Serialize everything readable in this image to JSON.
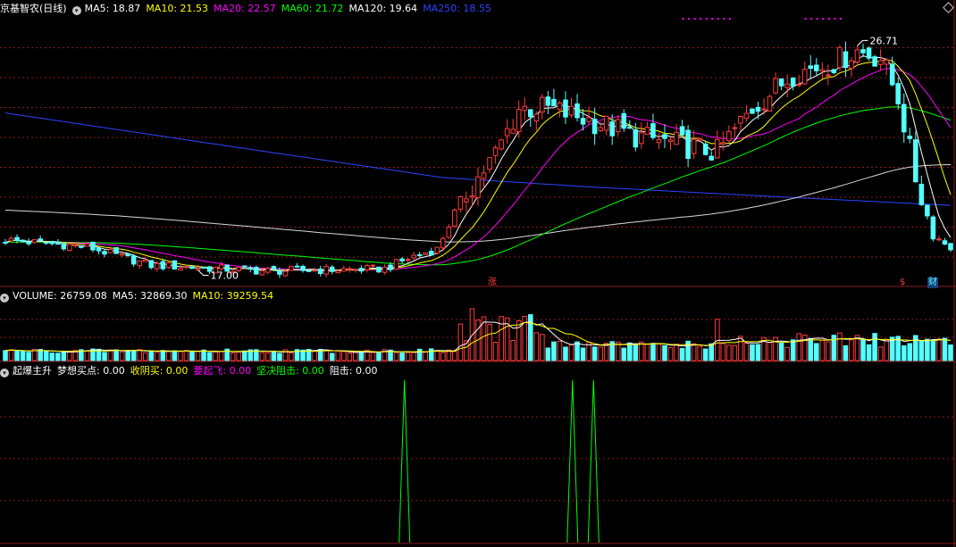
{
  "app": {
    "title": "京基智农(日线)"
  },
  "main_header": [
    {
      "label": "MA5: 18.87",
      "color": "#ffffff"
    },
    {
      "label": "MA10: 21.53",
      "color": "#ffff00"
    },
    {
      "label": "MA20: 22.57",
      "color": "#ff00ff"
    },
    {
      "label": "MA60: 21.72",
      "color": "#00ff00"
    },
    {
      "label": "MA120: 19.64",
      "color": "#ffffff"
    },
    {
      "label": "MA250: 18.55",
      "color": "#2b44ff"
    }
  ],
  "volume_header": [
    {
      "label": "VOLUME: 26759.08",
      "color": "#ffffff"
    },
    {
      "label": "MA5: 32869.30",
      "color": "#ffffff"
    },
    {
      "label": "MA10: 39259.54",
      "color": "#ffff00"
    }
  ],
  "indicator_header": {
    "name": "起爆主升",
    "items": [
      {
        "label": "梦想买点: 0.00",
        "color": "#ffffff"
      },
      {
        "label": "收阴买: 0.00",
        "color": "#ffff00"
      },
      {
        "label": "要起飞: 0.00",
        "color": "#ff00ff"
      },
      {
        "label": "坚决阻击: 0.00",
        "color": "#00ff00"
      },
      {
        "label": "阻击: 0.00",
        "color": "#ffffff"
      }
    ]
  },
  "markers": {
    "zhang": "涨",
    "s": "$",
    "cai": "财"
  },
  "colors": {
    "up": "#ff3c3c",
    "down": "#54ffff",
    "grid": "#8a1c1c",
    "ma250": "#2b44ff",
    "signal": "#00ff00"
  },
  "chart_data": [
    {
      "type": "candlestick",
      "title": "京基智农(日线)",
      "annotations": [
        {
          "text": "26.71",
          "kind": "high"
        },
        {
          "text": "17.00",
          "kind": "low"
        }
      ],
      "ylim": [
        16.4,
        28.0
      ],
      "anchors": [
        [
          0,
          18.3
        ],
        [
          14,
          18.0
        ],
        [
          25,
          17.2
        ],
        [
          45,
          16.95
        ],
        [
          65,
          17.05
        ],
        [
          70,
          17.6
        ],
        [
          74,
          17.9
        ],
        [
          78,
          20.0
        ],
        [
          84,
          22.0
        ],
        [
          88,
          24.0
        ],
        [
          93,
          24.0
        ],
        [
          100,
          23.5
        ],
        [
          108,
          22.8
        ],
        [
          118,
          22.3
        ],
        [
          122,
          22.1
        ],
        [
          128,
          24.0
        ],
        [
          135,
          25.5
        ],
        [
          142,
          26.0
        ],
        [
          146,
          26.5
        ],
        [
          150,
          26.2
        ],
        [
          153,
          24.5
        ],
        [
          156,
          21.0
        ],
        [
          159,
          18.5
        ],
        [
          162,
          18.0
        ]
      ],
      "series": [
        {
          "name": "MA5",
          "color": "#ffffff"
        },
        {
          "name": "MA10",
          "color": "#ffff00"
        },
        {
          "name": "MA20",
          "color": "#ff00ff"
        },
        {
          "name": "MA60",
          "color": "#00ff00"
        },
        {
          "name": "MA120",
          "color": "#ffffff"
        },
        {
          "name": "MA250",
          "color": "#2b44ff",
          "values": [
            [
              0,
              23.8
            ],
            [
              40,
              22.3
            ],
            [
              75,
              21.0
            ],
            [
              100,
              20.6
            ],
            [
              130,
              20.2
            ],
            [
              162,
              19.8
            ]
          ]
        }
      ]
    },
    {
      "type": "bar",
      "title": "VOLUME",
      "ylim": [
        0,
        100000
      ]
    },
    {
      "type": "line",
      "title": "起爆主升",
      "spikes": [
        {
          "x": 57,
          "value": 1
        },
        {
          "x": 81,
          "value": 1
        },
        {
          "x": 84,
          "value": 1
        }
      ]
    }
  ]
}
